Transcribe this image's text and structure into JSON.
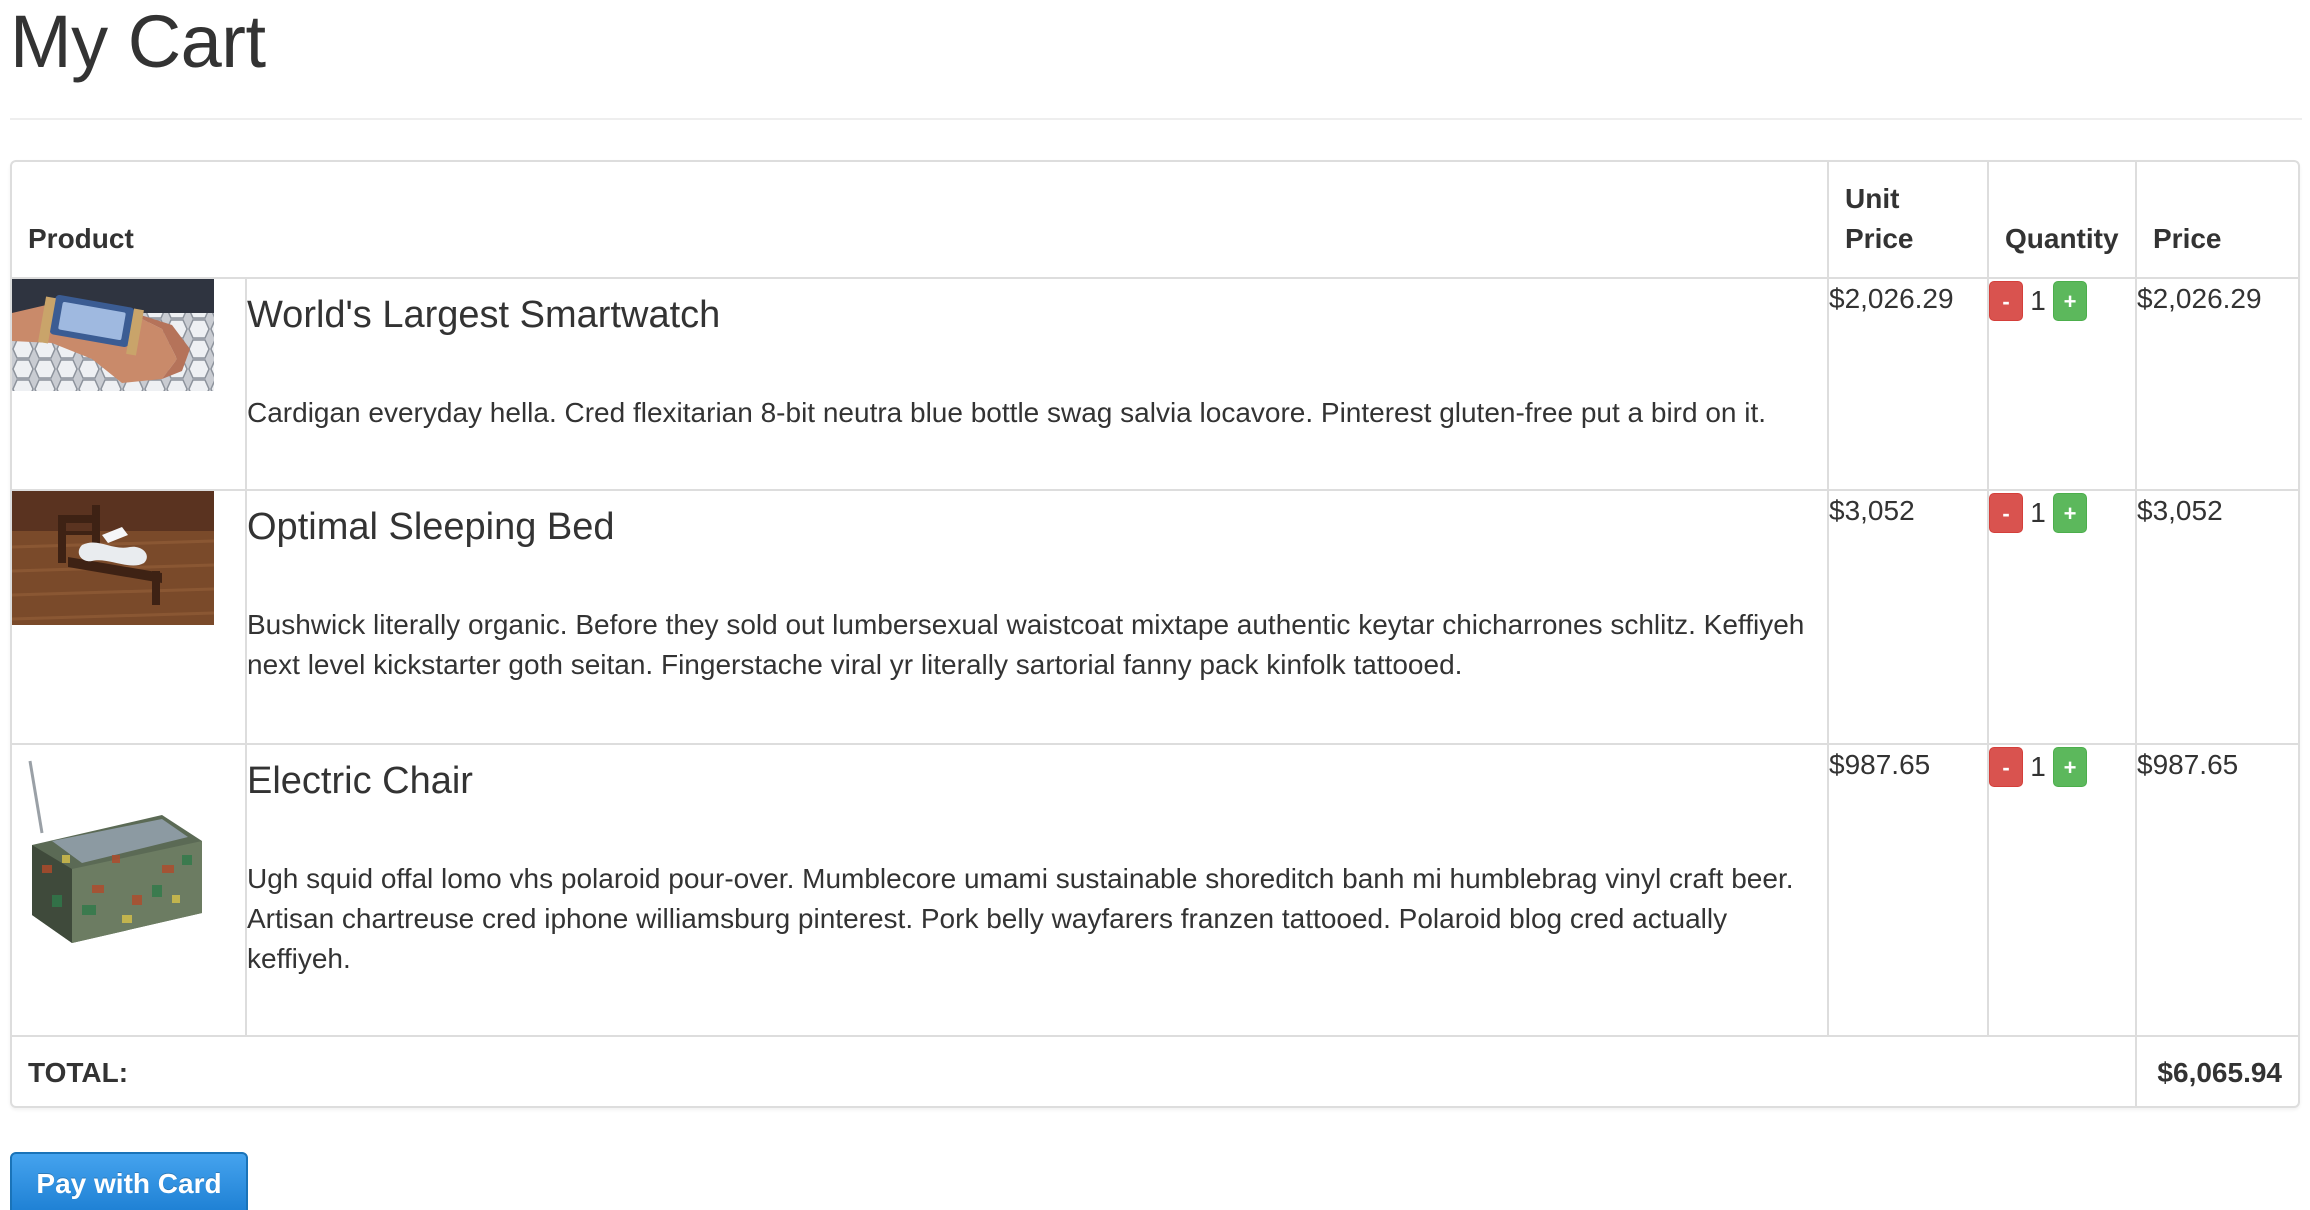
{
  "page": {
    "title": "My Cart"
  },
  "table": {
    "headers": {
      "product": "Product",
      "unit_price_line1": "Unit",
      "unit_price_line2": "Price",
      "quantity": "Quantity",
      "price": "Price"
    },
    "items": [
      {
        "name": "World's Largest Smartwatch",
        "description": "Cardigan everyday hella. Cred flexitarian 8-bit neutra blue bottle swag salvia locavore. Pinterest gluten-free put a bird on it.",
        "unit_price": "$2,026.29",
        "quantity": "1",
        "price": "$2,026.29",
        "image_icon": "smartwatch-photo"
      },
      {
        "name": "Optimal Sleeping Bed",
        "description": "Bushwick literally organic. Before they sold out lumbersexual waistcoat mixtape authentic keytar chicharrones schlitz. Keffiyeh next level kickstarter goth seitan. Fingerstache viral yr literally sartorial fanny pack kinfolk tattooed.",
        "unit_price": "$3,052",
        "quantity": "1",
        "price": "$3,052",
        "image_icon": "bed-photo"
      },
      {
        "name": "Electric Chair",
        "description": "Ugh squid offal lomo vhs polaroid pour-over. Mumblecore umami sustainable shoreditch banh mi humblebrag vinyl craft beer. Artisan chartreuse cred iphone williamsburg pinterest. Pork belly wayfarers franzen tattooed. Polaroid blog cred actually keffiyeh.",
        "unit_price": "$987.65",
        "quantity": "1",
        "price": "$987.65",
        "image_icon": "chair-photo"
      }
    ],
    "quantity_controls": {
      "decrement_label": "-",
      "increment_label": "+"
    },
    "total": {
      "label": "TOTAL:",
      "amount": "$6,065.94"
    }
  },
  "actions": {
    "pay_label": "Pay with Card"
  },
  "colors": {
    "decrement": "#d9534f",
    "increment": "#5cb85c",
    "pay_button": "#2b8fdc",
    "border": "#dddddd",
    "text": "#333333"
  }
}
